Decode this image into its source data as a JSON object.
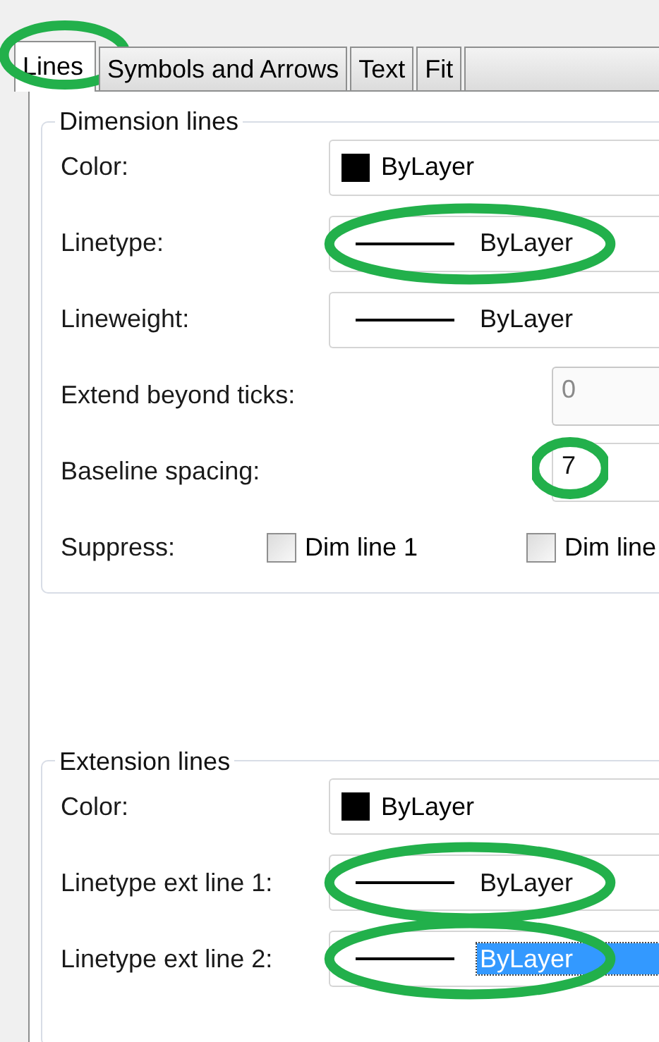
{
  "tabs": [
    {
      "label": "Lines",
      "selected": true,
      "circled": true
    },
    {
      "label": "Symbols and Arrows",
      "selected": false,
      "circled": false
    },
    {
      "label": "Text",
      "selected": false,
      "circled": false
    },
    {
      "label": "Fit",
      "selected": false,
      "circled": false
    }
  ],
  "groups": [
    {
      "title": "Dimension lines",
      "rows": [
        {
          "kind": "color",
          "label": "Color:",
          "value": "ByLayer",
          "circled": false
        },
        {
          "kind": "linetype",
          "label": "Linetype:",
          "value": "ByLayer",
          "selected": false,
          "circled": true
        },
        {
          "kind": "linetype",
          "label": "Lineweight:",
          "value": "ByLayer",
          "selected": false,
          "circled": false
        },
        {
          "kind": "number",
          "label": "Extend beyond ticks:",
          "value": "0",
          "disabled": true,
          "circled": false
        },
        {
          "kind": "number",
          "label": "Baseline spacing:",
          "value": "7",
          "disabled": false,
          "circled": true
        },
        {
          "kind": "checks",
          "label": "Suppress:",
          "options": [
            {
              "label": "Dim line 1",
              "checked": false
            },
            {
              "label": "Dim line",
              "checked": false
            }
          ]
        }
      ]
    },
    {
      "title": "Extension lines",
      "rows": [
        {
          "kind": "color",
          "label": "Color:",
          "value": "ByLayer",
          "circled": false
        },
        {
          "kind": "linetype",
          "label": "Linetype ext line 1:",
          "value": "ByLayer",
          "selected": false,
          "circled": true
        },
        {
          "kind": "linetype",
          "label": "Linetype ext line 2:",
          "value": "ByLayer",
          "selected": true,
          "circled": true
        }
      ]
    }
  ]
}
